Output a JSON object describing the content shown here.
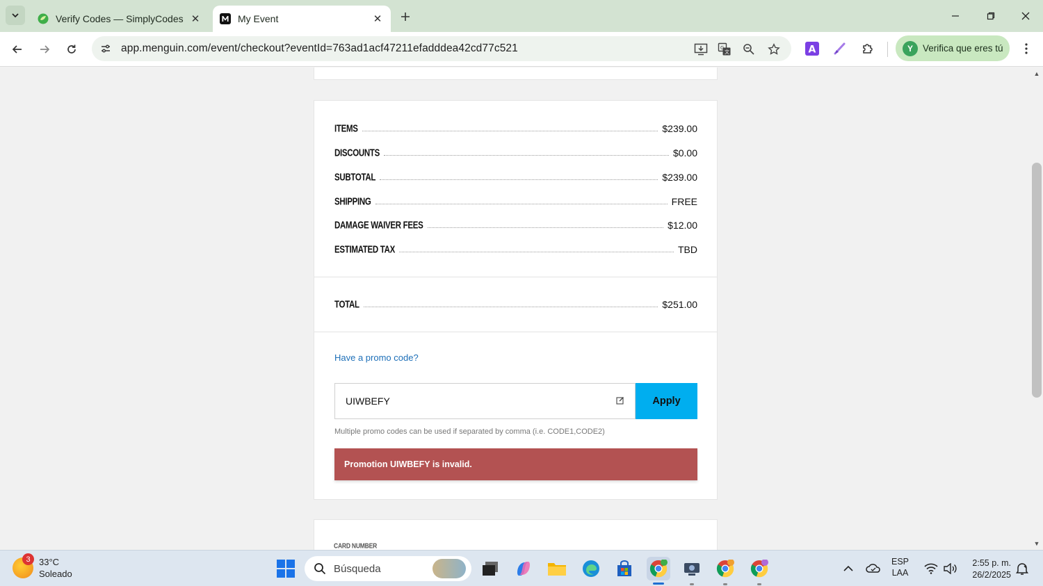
{
  "browser": {
    "tabs": [
      {
        "title": "Verify Codes — SimplyCodes",
        "active": false,
        "favicon": "simplycodes-leaf-icon"
      },
      {
        "title": "My Event",
        "active": true,
        "favicon": "menguin-m-icon"
      }
    ],
    "url": "app.menguin.com/event/checkout?eventId=763ad1acf47211efadddea42cd77c521",
    "profile_label": "Verifica que eres tú",
    "profile_initial": "Y"
  },
  "summary": {
    "rows": [
      {
        "label": "Items",
        "value": "$239.00"
      },
      {
        "label": "Discounts",
        "value": "$0.00"
      },
      {
        "label": "Subtotal",
        "value": "$239.00"
      },
      {
        "label": "Shipping",
        "value": "FREE"
      },
      {
        "label": "Damage Waiver Fees",
        "value": "$12.00"
      },
      {
        "label": "Estimated Tax",
        "value": "TBD"
      }
    ],
    "total_label": "Total",
    "total_value": "$251.00"
  },
  "promo": {
    "link_text": "Have a promo code?",
    "input_value": "UIWBEFY",
    "apply_label": "Apply",
    "helper_text": "Multiple promo codes can be used if separated by comma (i.e. CODE1,CODE2)",
    "error_text": "Promotion UIWBEFY is invalid."
  },
  "payment": {
    "card_number_label": "Card Number"
  },
  "taskbar": {
    "weather_temp": "33°C",
    "weather_desc": "Soleado",
    "weather_badge": "3",
    "search_placeholder": "Búsqueda",
    "lang_top": "ESP",
    "lang_bottom": "LAA",
    "time": "2:55 p. m.",
    "date": "26/2/2025"
  },
  "colors": {
    "apply_button": "#00aeef",
    "error_background": "#b35252",
    "link": "#1d6fb8",
    "tabbar": "#d3e3d2"
  }
}
